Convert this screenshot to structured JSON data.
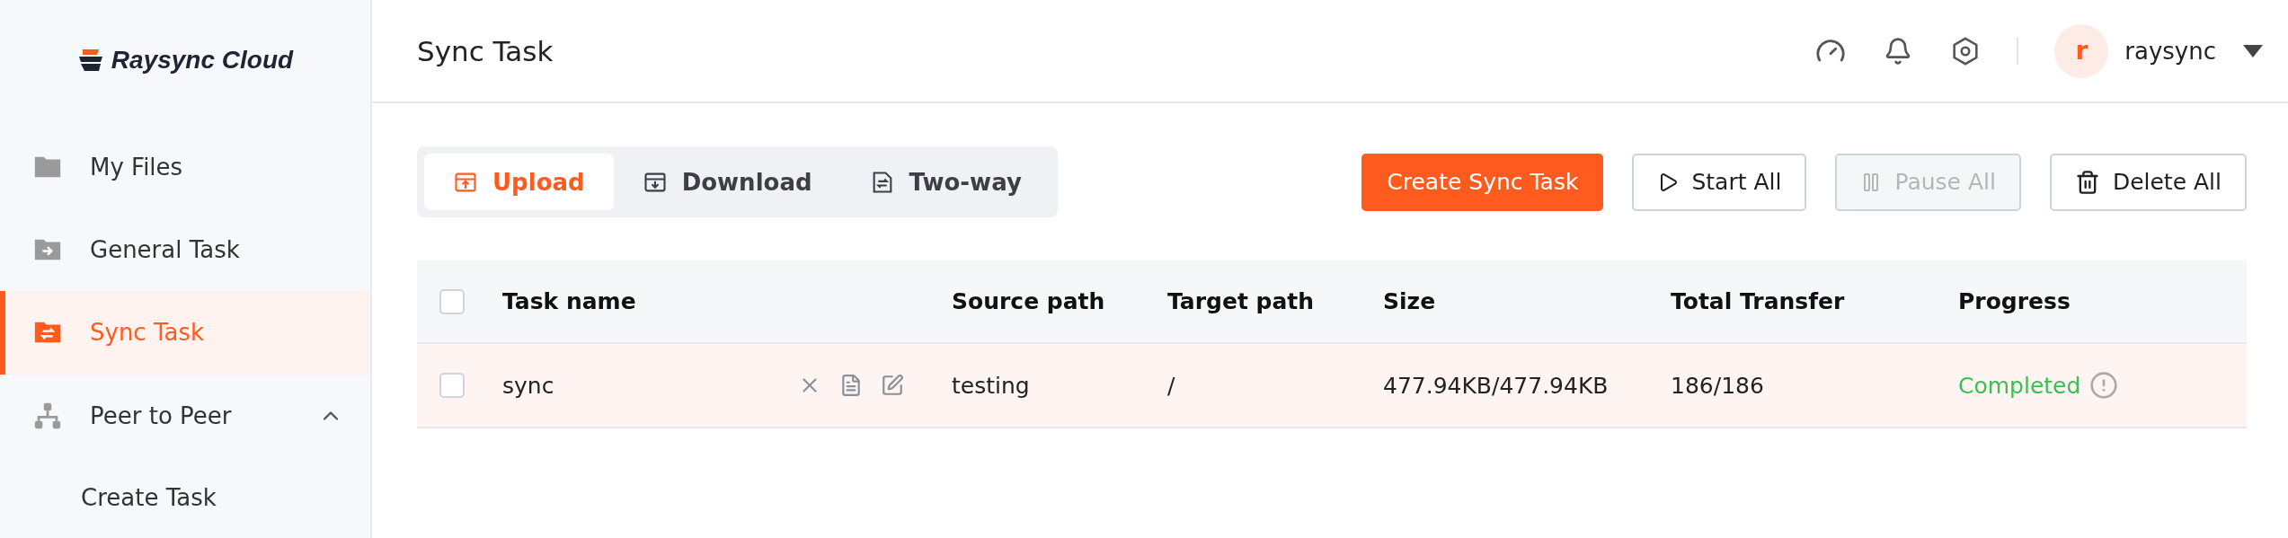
{
  "logo": {
    "text": "Raysync Cloud"
  },
  "sidebar": {
    "items": [
      {
        "label": "My Files",
        "kind": "files",
        "selected": false
      },
      {
        "label": "General Task",
        "kind": "general",
        "selected": false
      },
      {
        "label": "Sync Task",
        "kind": "sync",
        "selected": true
      },
      {
        "label": "Peer to Peer",
        "kind": "peer",
        "selected": false,
        "expanded": true,
        "children": [
          {
            "label": "Create Task",
            "selected": false
          }
        ]
      }
    ]
  },
  "header": {
    "title": "Sync Task",
    "user": {
      "initial": "r",
      "name": "raysync"
    }
  },
  "tabs": [
    {
      "label": "Upload",
      "kind": "upload",
      "selected": true
    },
    {
      "label": "Download",
      "kind": "download",
      "selected": false
    },
    {
      "label": "Two-way",
      "kind": "twoway",
      "selected": false
    }
  ],
  "actions": [
    {
      "label": "Create Sync Task",
      "kind": "primary",
      "disabled": false
    },
    {
      "label": "Start All",
      "kind": "start",
      "disabled": false
    },
    {
      "label": "Pause All",
      "kind": "pause",
      "disabled": true
    },
    {
      "label": "Delete All",
      "kind": "delete",
      "disabled": false
    }
  ],
  "table": {
    "all_checked": false,
    "columns": [
      "Task name",
      "Source path",
      "Target path",
      "Size",
      "Total Transfer",
      "Progress"
    ],
    "rows": [
      {
        "checked": false,
        "selected": true,
        "task_name": "sync",
        "source_path": "testing",
        "target_path": "/",
        "size": "477.94KB/477.94KB",
        "total_transfer": "186/186",
        "progress": "Completed"
      }
    ]
  }
}
